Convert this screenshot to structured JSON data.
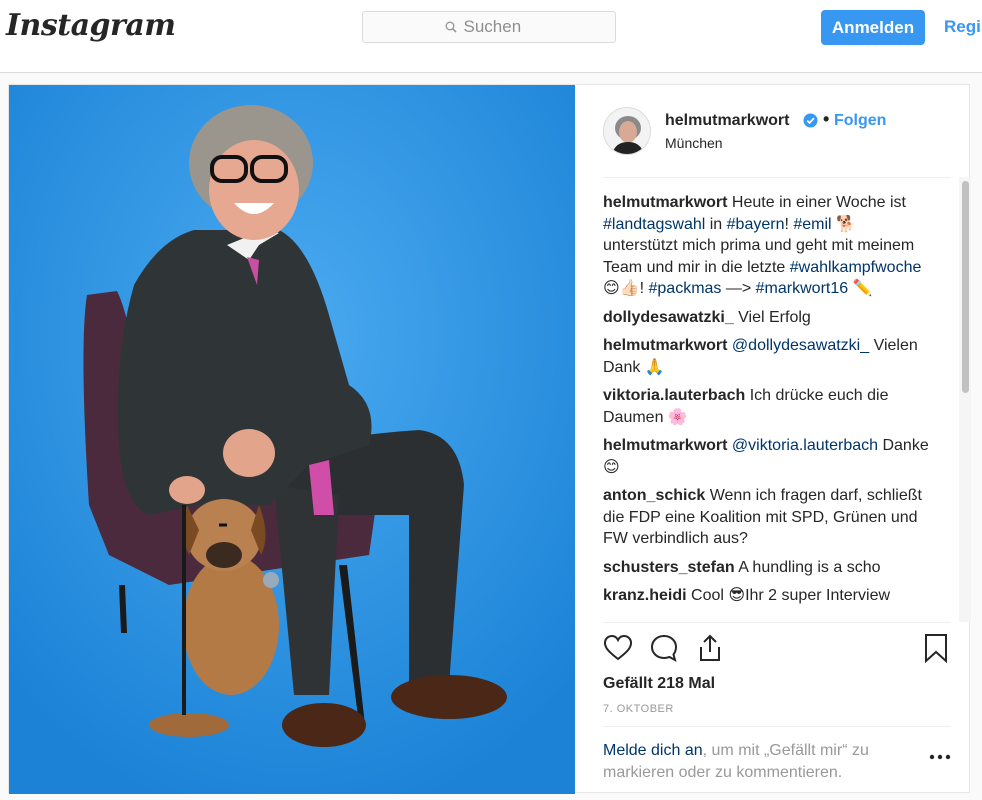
{
  "header": {
    "logo": "Instagram",
    "search_placeholder": "Suchen",
    "login_button": "Anmelden",
    "register_link": "Regis"
  },
  "post": {
    "username": "helmutmarkwort",
    "verified": true,
    "dot": "•",
    "follow": "Folgen",
    "location": "München",
    "comments": [
      {
        "user": "helmutmarkwort",
        "parts": [
          {
            "t": "Heute in einer Woche ist "
          },
          {
            "t": "#landtagswahl",
            "tag": true
          },
          {
            "t": " in "
          },
          {
            "t": "#bayern",
            "tag": true
          },
          {
            "t": "! "
          },
          {
            "t": "#emil",
            "tag": true
          },
          {
            "t": " 🐕 unterstützt mich prima und geht mit meinem Team und mir in die letzte "
          },
          {
            "t": "#wahlkampfwoche",
            "tag": true
          },
          {
            "t": " 😊👍🏻! "
          },
          {
            "t": "#packmas",
            "tag": true
          },
          {
            "t": " —> "
          },
          {
            "t": "#markwort16",
            "tag": true
          },
          {
            "t": " ✏️"
          }
        ]
      },
      {
        "user": "dollydesawatzki_",
        "parts": [
          {
            "t": "Viel Erfolg"
          }
        ]
      },
      {
        "user": "helmutmarkwort",
        "parts": [
          {
            "t": "@dollydesawatzki_",
            "tag": true
          },
          {
            "t": " Vielen Dank 🙏"
          }
        ]
      },
      {
        "user": "viktoria.lauterbach",
        "parts": [
          {
            "t": "Ich drücke euch die Daumen 🌸"
          }
        ]
      },
      {
        "user": "helmutmarkwort",
        "parts": [
          {
            "t": "@viktoria.lauterbach",
            "tag": true
          },
          {
            "t": " Danke😊"
          }
        ]
      },
      {
        "user": "anton_schick",
        "parts": [
          {
            "t": "Wenn ich fragen darf, schließt die FDP eine Koalition mit SPD, Grünen und FW verbindlich aus?"
          }
        ]
      },
      {
        "user": "schusters_stefan",
        "parts": [
          {
            "t": "A hundling is a scho"
          }
        ]
      },
      {
        "user": "kranz.heidi",
        "parts": [
          {
            "t": "Cool 😎Ihr 2 super Interview"
          }
        ]
      }
    ],
    "likes": "Gefällt 218 Mal",
    "date": "7. OKTOBER",
    "login_prompt_link": "Melde dich an",
    "login_prompt_rest": ", um mit „Gefällt mir“ zu markieren oder zu kommentieren.",
    "more_dots": "•••"
  },
  "colors": {
    "accent": "#3897f0",
    "hashtag": "#003569",
    "photo_bg": "#2a95e6"
  }
}
